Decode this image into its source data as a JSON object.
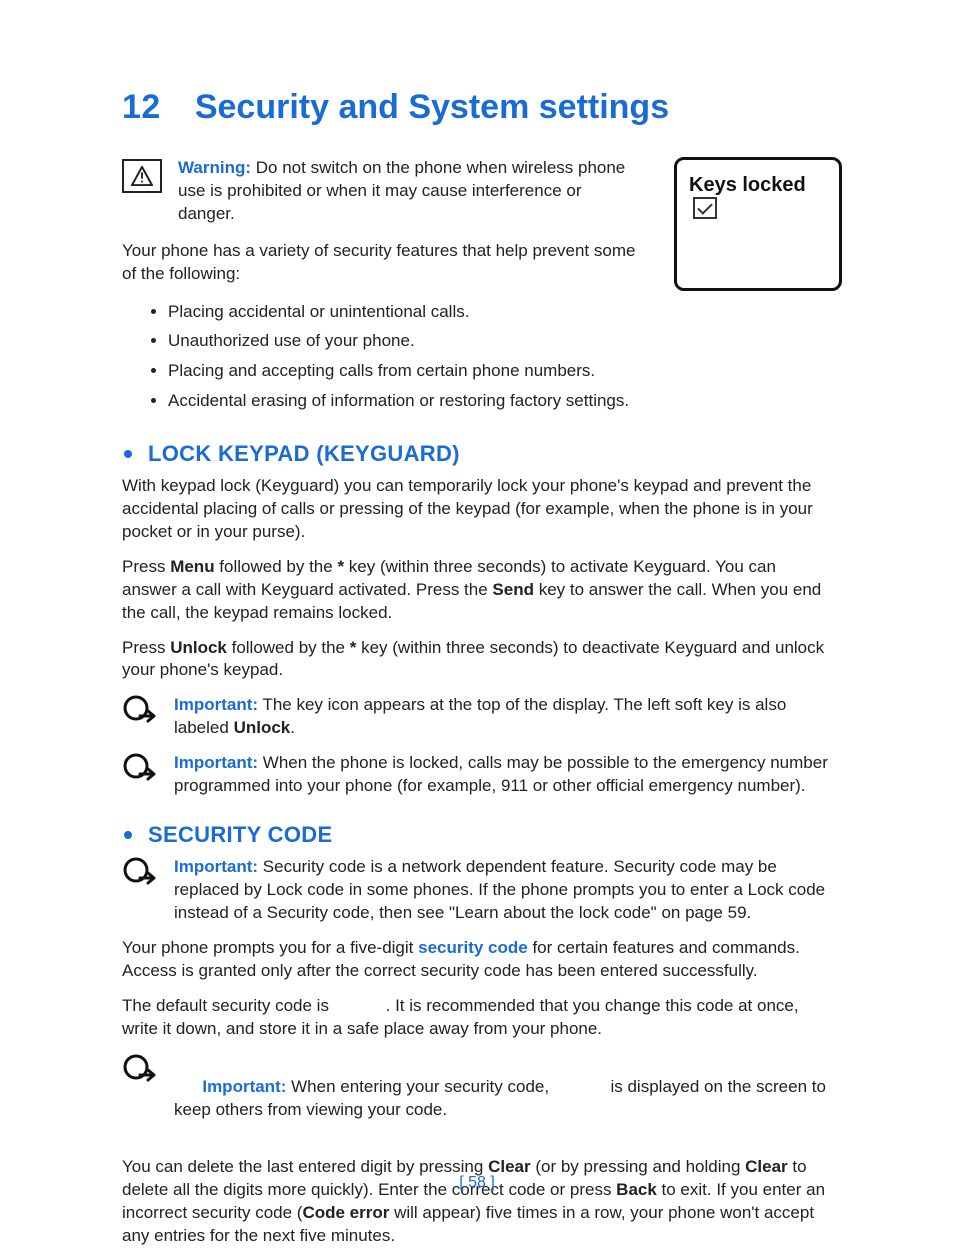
{
  "chapter": {
    "number": "12",
    "title": "Security and System settings"
  },
  "keys_figure": {
    "label": "Keys locked"
  },
  "warning": {
    "label": "Warning:",
    "text": " Do not switch on the phone when wireless phone use is prohibited or when it may cause interference or danger."
  },
  "intro_para": "Your phone has a variety of security features that help prevent some of the following:",
  "intro_bullets": [
    "Placing accidental or unintentional calls.",
    "Unauthorized use of your phone.",
    "Placing and accepting calls from certain phone numbers.",
    "Accidental erasing of information or restoring factory settings."
  ],
  "section1": {
    "title": "LOCK KEYPAD (KEYGUARD)",
    "p1": "With keypad lock (Keyguard) you can temporarily lock your phone's keypad and prevent the accidental placing of calls or pressing of the keypad (for example, when the phone is in your pocket or in your purse).",
    "p2_parts": {
      "a": "Press ",
      "b_menu": "Menu",
      "c": " followed by the ",
      "d_star": "*",
      "e": " key (within three seconds) to activate Keyguard. You can answer a call with Keyguard activated. Press the ",
      "f_send": "Send",
      "g": " key to answer the call. When you end the call, the keypad remains locked."
    },
    "p3_parts": {
      "a": "Press ",
      "b_unlock": "Unlock",
      "c": " followed by the ",
      "d_star": "*",
      "e": " key (within three seconds) to deactivate Keyguard and unlock your phone's keypad."
    },
    "imp1": {
      "label": "Important:",
      "a": " The key icon appears at the top of the display. The left soft key is also labeled ",
      "b_unlock": "Unlock",
      "c": "."
    },
    "imp2": {
      "label": "Important:",
      "text": " When the phone is locked, calls may be possible to the emergency number programmed into your phone (for example, 911 or other official emergency number)."
    }
  },
  "section2": {
    "title": "SECURITY CODE",
    "imp1": {
      "label": "Important:",
      "text": " Security code is a network dependent feature. Security code may be replaced by Lock code in some phones. If the phone prompts you to enter a Lock code instead of a Security code, then see \"Learn about the lock code\" on page 59."
    },
    "p1_parts": {
      "a": "Your phone prompts you for a five-digit ",
      "b_term": "security code",
      "c": " for certain features and commands. Access is granted only after the correct security code has been entered successfully."
    },
    "p2": "The default security code is            . It is recommended that you change this code at once, write it down, and store it in a safe place away from your phone.",
    "imp2": {
      "label": "Important:",
      "text": " When entering your security code,             is displayed on the screen to keep others from viewing your code."
    },
    "p3_parts": {
      "a": "You can delete the last entered digit by pressing ",
      "b_clear": "Clear",
      "c": " (or by pressing and holding ",
      "d_clear2": "Clear",
      "e": " to delete all the digits more quickly). Enter the correct code or press ",
      "f_back": "Back",
      "g": " to exit. If you enter an incorrect security code (",
      "h_err": "Code error",
      "i": " will appear) five times in a row, your phone won't accept any entries for the next five minutes."
    }
  },
  "footer": "[ 58 ]"
}
